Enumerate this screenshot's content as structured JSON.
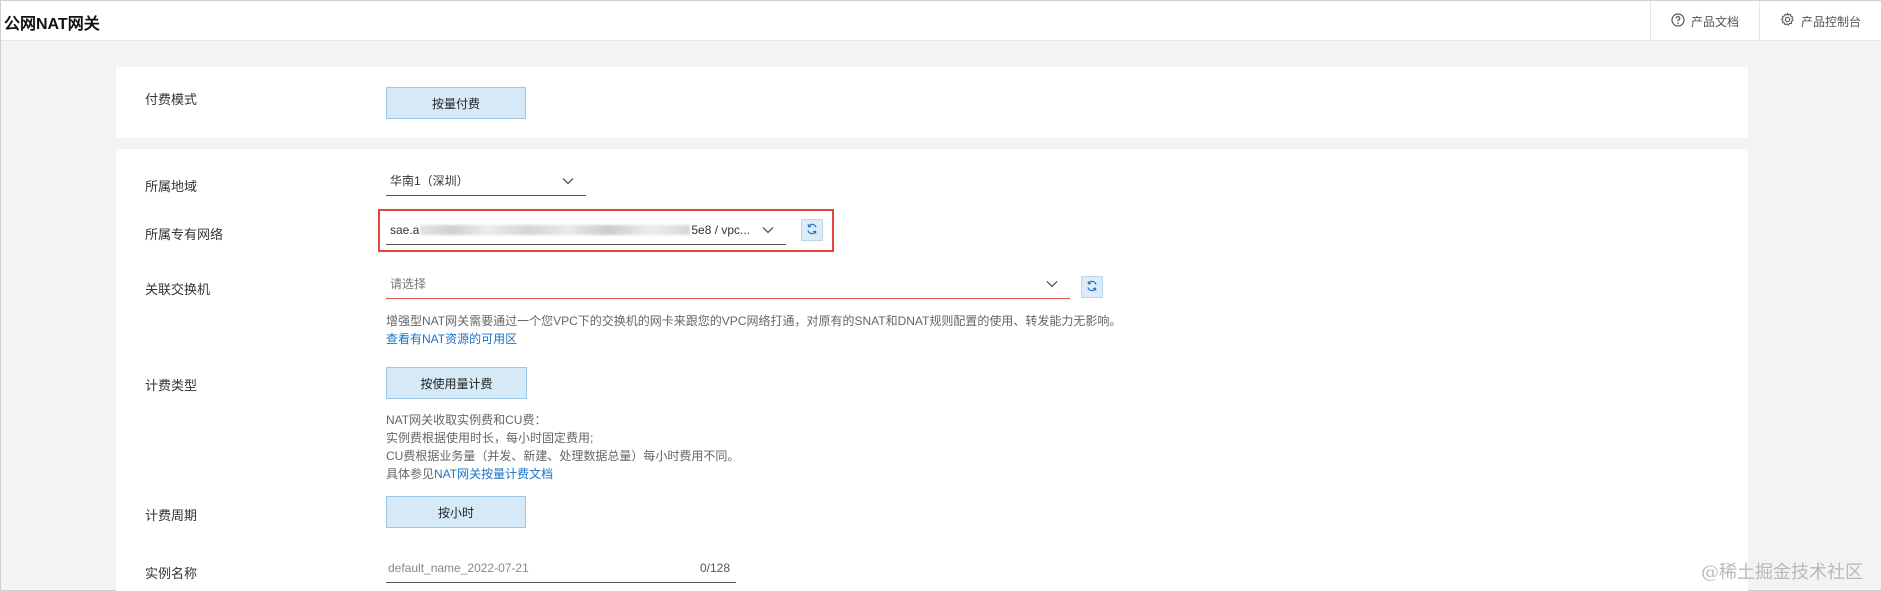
{
  "header": {
    "title": "公网NAT网关",
    "links": [
      {
        "label": "产品文档",
        "icon": "help-circle-icon"
      },
      {
        "label": "产品控制台",
        "icon": "gear-icon"
      }
    ]
  },
  "pay_mode": {
    "label": "付费模式",
    "option": "按量付费"
  },
  "region": {
    "label": "所属地域",
    "value": "华南1（深圳）"
  },
  "vpc": {
    "label": "所属专有网络",
    "value_prefix": "sae.a",
    "value_suffix": "5e8 / vpc..."
  },
  "vswitch": {
    "label": "关联交换机",
    "placeholder": "请选择",
    "hint": "增强型NAT网关需要通过一个您VPC下的交换机的网卡来跟您的VPC网络打通，对原有的SNAT和DNAT规则配置的使用、转发能力无影响。",
    "link": "查看有NAT资源的可用区"
  },
  "billing_type": {
    "label": "计费类型",
    "option": "按使用量计费",
    "notes": [
      "NAT网关收取实例费和CU费：",
      "实例费根据使用时长，每小时固定费用;",
      "CU费根据业务量（并发、新建、处理数据总量）每小时费用不同。"
    ],
    "doc_prefix": "具体参见",
    "doc_link": "NAT网关按量计费文档"
  },
  "billing_cycle": {
    "label": "计费周期",
    "option": "按小时"
  },
  "instance_name": {
    "label": "实例名称",
    "value": "default_name_2022-07-21",
    "counter": "0/128"
  },
  "watermark": "@稀土掘金技术社区",
  "colors": {
    "accent_fill": "#d6e9f7",
    "link": "#1a73c8",
    "highlight": "#e3463c",
    "error_underline": "#d9534f"
  }
}
